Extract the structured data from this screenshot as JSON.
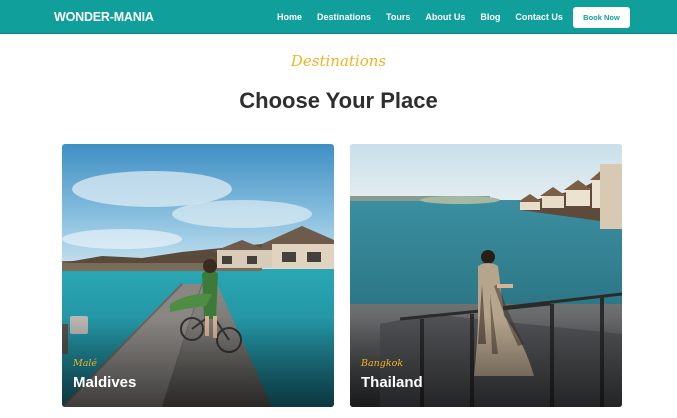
{
  "brand": {
    "logo": "WONDER-MANIA",
    "accent": "#109f9b",
    "highlight": "#f0b323"
  },
  "nav": {
    "items": [
      {
        "label": "Home"
      },
      {
        "label": "Destinations"
      },
      {
        "label": "Tours"
      },
      {
        "label": "About Us"
      },
      {
        "label": "Blog"
      },
      {
        "label": "Contact Us"
      }
    ],
    "book_label": "Book Now"
  },
  "section": {
    "tag": "Destinations",
    "title": "Choose Your Place"
  },
  "cards": [
    {
      "subtitle": "Malé",
      "name": "Maldives"
    },
    {
      "subtitle": "Bangkok",
      "name": "Thailand"
    }
  ]
}
